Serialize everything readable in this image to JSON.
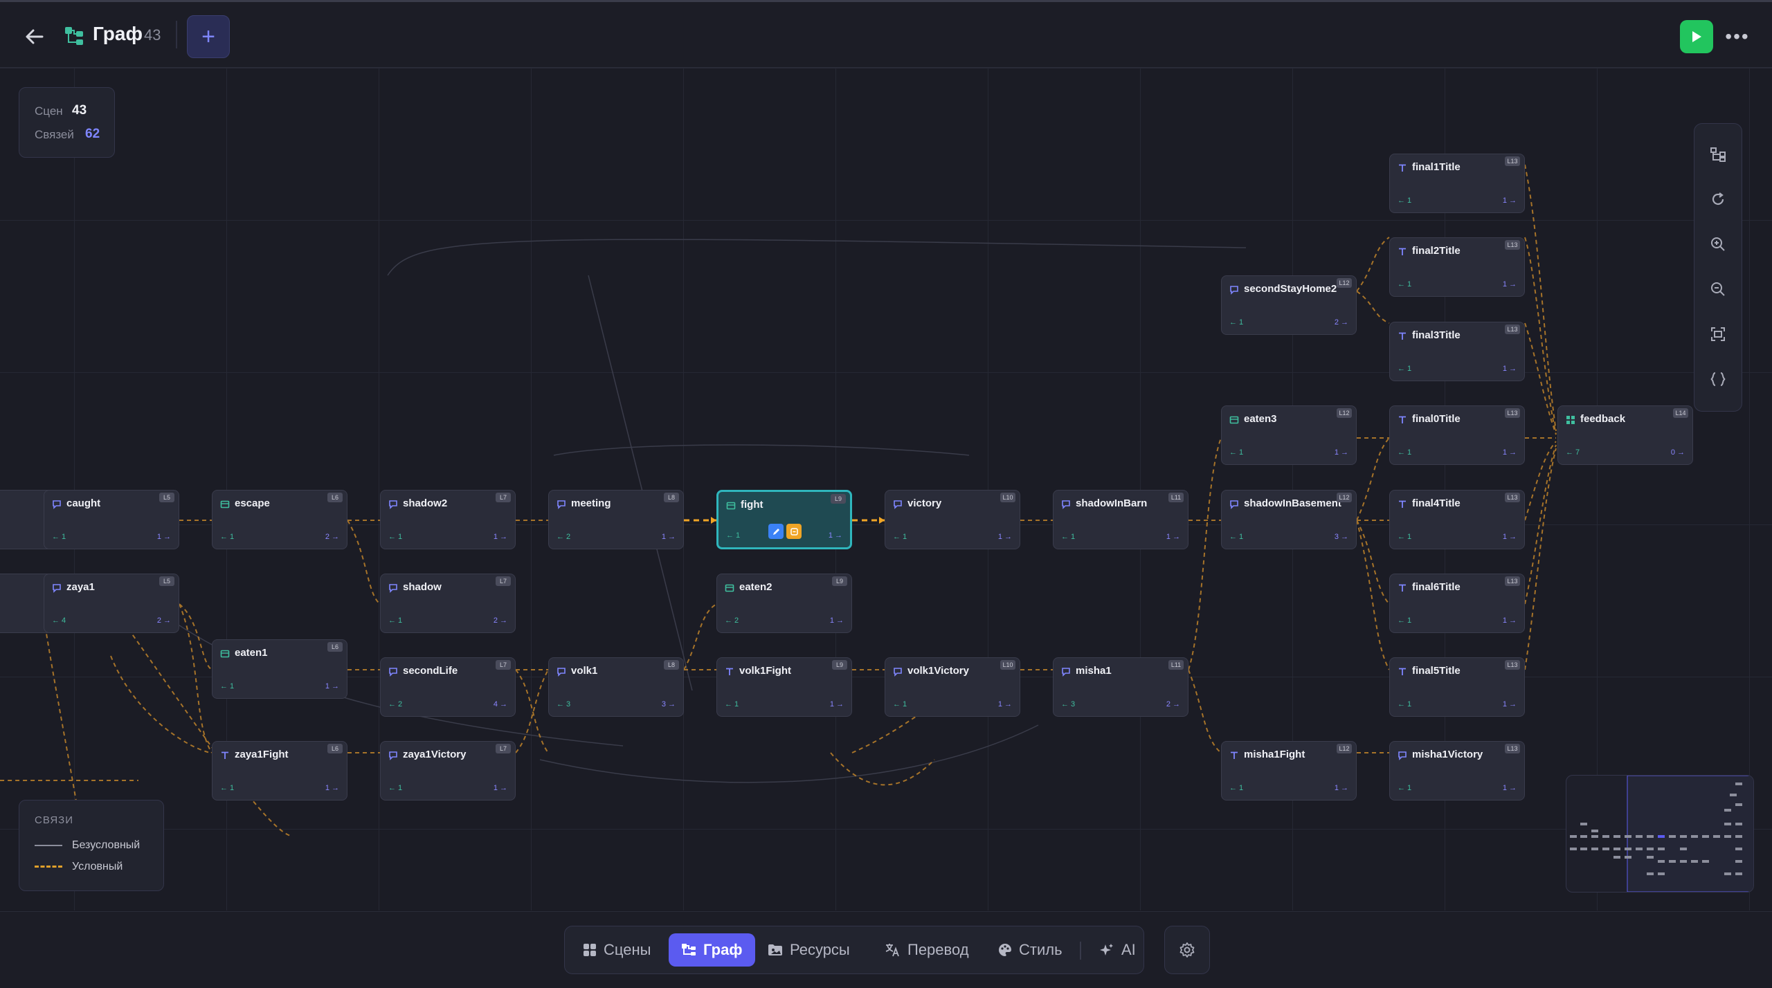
{
  "header": {
    "title": "Граф",
    "count": "43"
  },
  "stats": {
    "scenes_label": "Сцен",
    "scenes_value": "43",
    "links_label": "Связей",
    "links_value": "62"
  },
  "colors": {
    "accent": "#5b5bf0",
    "play": "#22c55e",
    "selected_node": "#2fb6bd",
    "conditional_edge": "#c9892a",
    "input_port": "#3fbf9f",
    "output_port": "#8a86ff"
  },
  "legend": {
    "title": "СВЯЗИ",
    "unconditional": "Безусловный",
    "conditional": "Условный"
  },
  "nodes": [
    {
      "label": "caught",
      "type": "dialog-icon",
      "badge": "L5",
      "in": "← 1",
      "out": "1 →"
    },
    {
      "label": "escape",
      "type": "scene-icon",
      "badge": "L6",
      "in": "← 1",
      "out": "2 →"
    },
    {
      "label": "shadow2",
      "type": "dialog-icon",
      "badge": "L7",
      "in": "← 1",
      "out": "1 →"
    },
    {
      "label": "meeting",
      "type": "dialog-icon",
      "badge": "L8",
      "in": "← 2",
      "out": "1 →"
    },
    {
      "label": "fight",
      "type": "scene-icon",
      "badge": "L9",
      "in": "← 1",
      "out": "1 →"
    },
    {
      "label": "victory",
      "type": "dialog-icon",
      "badge": "L10",
      "in": "← 1",
      "out": "1 →"
    },
    {
      "label": "shadowInBarn",
      "type": "dialog-icon",
      "badge": "L11",
      "in": "← 1",
      "out": "1 →"
    },
    {
      "label": "shadowInBasement",
      "type": "dialog-icon",
      "badge": "L12",
      "in": "← 1",
      "out": "3 →"
    },
    {
      "label": "zaya1",
      "type": "dialog-icon",
      "badge": "L5",
      "in": "← 4",
      "out": "2 →"
    },
    {
      "label": "shadow",
      "type": "dialog-icon",
      "badge": "L7",
      "in": "← 1",
      "out": "2 →"
    },
    {
      "label": "eaten2",
      "type": "scene-icon",
      "badge": "L9",
      "in": "← 2",
      "out": "1 →"
    },
    {
      "label": "eaten1",
      "type": "scene-icon",
      "badge": "L6",
      "in": "← 1",
      "out": "1 →"
    },
    {
      "label": "secondLife",
      "type": "dialog-icon",
      "badge": "L7",
      "in": "← 2",
      "out": "4 →"
    },
    {
      "label": "volk1",
      "type": "dialog-icon",
      "badge": "L8",
      "in": "← 3",
      "out": "3 →"
    },
    {
      "label": "volk1Fight",
      "type": "title-icon",
      "badge": "L9",
      "in": "← 1",
      "out": "1 →"
    },
    {
      "label": "volk1Victory",
      "type": "dialog-icon",
      "badge": "L10",
      "in": "← 1",
      "out": "1 →"
    },
    {
      "label": "misha1",
      "type": "dialog-icon",
      "badge": "L11",
      "in": "← 3",
      "out": "2 →"
    },
    {
      "label": "zaya1Fight",
      "type": "title-icon",
      "badge": "L6",
      "in": "← 1",
      "out": "1 →"
    },
    {
      "label": "zaya1Victory",
      "type": "dialog-icon",
      "badge": "L7",
      "in": "← 1",
      "out": "1 →"
    },
    {
      "label": "misha1Fight",
      "type": "title-icon",
      "badge": "L12",
      "in": "← 1",
      "out": "1 →"
    },
    {
      "label": "misha1Victory",
      "type": "dialog-icon",
      "badge": "L13",
      "in": "← 1",
      "out": "1 →"
    },
    {
      "label": "secondStayHome2",
      "type": "dialog-icon",
      "badge": "L12",
      "in": "← 1",
      "out": "2 →"
    },
    {
      "label": "eaten3",
      "type": "scene-icon",
      "badge": "L12",
      "in": "← 1",
      "out": "1 →"
    },
    {
      "label": "final1Title",
      "type": "title-icon",
      "badge": "L13",
      "in": "← 1",
      "out": "1 →"
    },
    {
      "label": "final2Title",
      "type": "title-icon",
      "badge": "L13",
      "in": "← 1",
      "out": "1 →"
    },
    {
      "label": "final3Title",
      "type": "title-icon",
      "badge": "L13",
      "in": "← 1",
      "out": "1 →"
    },
    {
      "label": "final0Title",
      "type": "title-icon",
      "badge": "L13",
      "in": "← 1",
      "out": "1 →"
    },
    {
      "label": "final4Title",
      "type": "title-icon",
      "badge": "L13",
      "in": "← 1",
      "out": "1 →"
    },
    {
      "label": "final6Title",
      "type": "title-icon",
      "badge": "L13",
      "in": "← 1",
      "out": "1 →"
    },
    {
      "label": "final5Title",
      "type": "title-icon",
      "badge": "L13",
      "in": "← 1",
      "out": "1 →"
    },
    {
      "label": "feedback",
      "type": "grid-icon",
      "badge": "L14",
      "in": "← 7",
      "out": "0 →"
    }
  ],
  "bottom_nav": {
    "scenes": "Сцены",
    "graph": "Граф",
    "resources": "Ресурсы",
    "translation": "Перевод",
    "style": "Стиль",
    "ai": "AI"
  }
}
